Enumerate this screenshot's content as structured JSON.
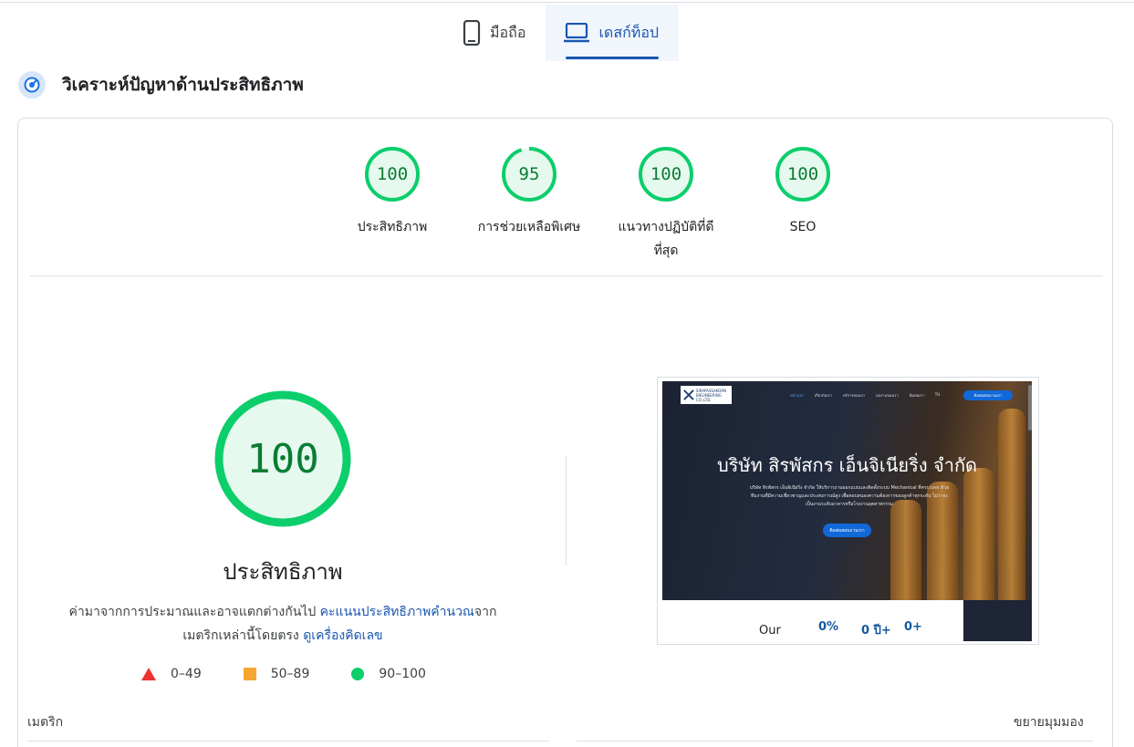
{
  "device_tabs": [
    {
      "label": "มือถือ",
      "icon": "smartphone-icon",
      "active": false
    },
    {
      "label": "เดสก์ท็อป",
      "icon": "laptop-icon",
      "active": true
    }
  ],
  "section": {
    "title": "วิเคราะห์ปัญหาด้านประสิทธิภาพ",
    "icon": "performance-icon"
  },
  "scores": [
    {
      "label": "ประสิทธิภาพ",
      "value": "100",
      "fraction": 1.0
    },
    {
      "label": "การช่วยเหลือพิเศษ",
      "value": "95",
      "fraction": 0.95
    },
    {
      "label_line1": "แนวทางปฏิบัติที่ดี",
      "label_line2": "ที่สุด",
      "value": "100",
      "fraction": 1.0
    },
    {
      "label": "SEO",
      "value": "100",
      "fraction": 1.0
    }
  ],
  "performance": {
    "score": "100",
    "title": "ประสิทธิภาพ",
    "desc_prefix": "ค่ามาจากการประมาณและอาจแตกต่างกันไป ",
    "desc_link1": "คะแนนประสิทธิภาพคำนวณ",
    "desc_mid": "จาก\nเมตริกเหล่านี้โดยตรง ",
    "desc_link2": "ดูเครื่องคิดเลข"
  },
  "legend": [
    {
      "range": "0–49",
      "shape": "triangle",
      "color": "#eb3333"
    },
    {
      "range": "50–89",
      "shape": "square",
      "color": "#f7a531"
    },
    {
      "range": "90–100",
      "shape": "circle",
      "color": "#0cce6b"
    }
  ],
  "thumbnail": {
    "logo_text_1": "SIRAPASSAKORN",
    "logo_text_2": "ENGINEERING CO.,LTD.",
    "nav": [
      "หน้าแรก",
      "เกี่ยวกับเรา",
      "บริการของเรา",
      "ผลงานของเรา",
      "ติดต่อเรา",
      "TH"
    ],
    "nav_cta": "ติดต่อสอบถามเรา",
    "hero_title": "บริษัท สิรพัสกร เอ็นจิเนียริ่ง จำกัด",
    "hero_sub": "บริษัท สิรพัสกร เอ็นจิเนียริ่ง จำกัด ให้บริการงานออกแบบและติดตั้งระบบ Mechanical ที่ครบวงจร ด้วยทีมงานที่มีความเชี่ยวชาญและประสบการณ์สูง เพื่อตอบสนองความต้องการของลูกค้าทุกระดับ ไม่ว่าจะเป็นงานระดับอาคารหรือโรงงานอุตสาหกรรม",
    "hero_button": "ติดต่อสอบถามเรา",
    "stat_label": "Our",
    "stats": [
      "0%",
      "0 ปี+",
      "0+"
    ]
  },
  "metrics_label": "เมตริก",
  "expand_label": "ขยายมุมมอง",
  "colors": {
    "accent": "#1a56b0",
    "pass": "#0cce6b",
    "pass_text": "#0a7d33",
    "pass_fill": "#e6f9ee"
  }
}
